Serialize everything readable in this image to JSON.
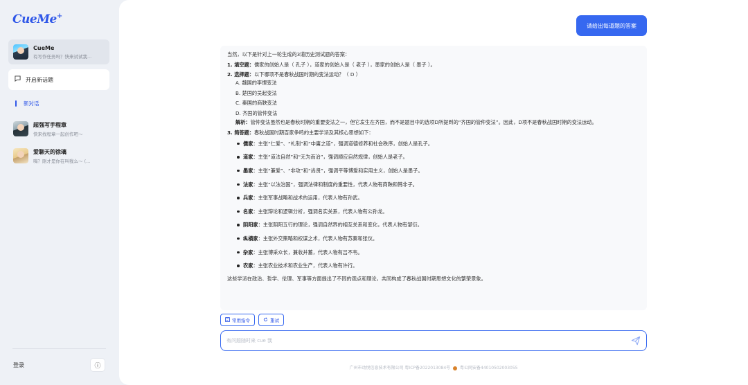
{
  "app": {
    "logo": "CueMe",
    "logo_plus": "+"
  },
  "sidebar": {
    "items": [
      {
        "title": "CueMe",
        "subtitle": "有写作任务吗？快来试试我..."
      },
      {
        "title": "超强写手程章",
        "subtitle": "快来找程章一起创作吧～"
      },
      {
        "title": "爱聊天的徐璃",
        "subtitle": "嗨？刚才是你在叫我么～ (..."
      }
    ],
    "new_topic": "开启新话题",
    "new_chat": "新对话",
    "login": "登录",
    "info_icon": "ⓘ"
  },
  "chat": {
    "user_message": "请给出每道题的答案",
    "answer": {
      "intro": "当然，以下是针对上一轮生成的3道历史测试题的答案：",
      "q1_head": "1. 填空题：",
      "q1_text": "儒家的创始人是（ 孔子 ），道家的创始人是（ 老子 ），墨家的创始人是（ 墨子 ）。",
      "q2_head": "2. 选择题：",
      "q2_text": "以下哪项不是春秋战国时期的变法运动？（ D ）",
      "q2_options": [
        "A. 魏国的李悝变法",
        "B. 楚国的吴起变法",
        "C. 秦国的商鞅变法",
        "D. 齐国的管仲变法"
      ],
      "q2_analysis_head": "解析：",
      "q2_analysis": "管仲变法虽然也是春秋时期的重要变法之一，但它发生在齐国，而不是题目中的选项D所提到的“齐国的管仲变法”。因此，D项不是春秋战国时期的变法运动。",
      "q3_head": "3. 简答题：",
      "q3_text": "春秋战国时期百家争鸣的主要学派及其核心思想如下：",
      "schools": [
        {
          "name": "儒家",
          "text": "：主张“仁爱”、“礼制”和“中庸之道”，强调道德修养和社会秩序，创始人是孔子。"
        },
        {
          "name": "道家",
          "text": "：主张“道法自然”和“无为而治”，强调顺应自然规律，创始人是老子。"
        },
        {
          "name": "墨家",
          "text": "：主张“兼爱”、“非攻”和“尚贤”，强调平等博爱和实用主义，创始人是墨子。"
        },
        {
          "name": "法家",
          "text": "：主张“以法治国”，强调法律和制度的重要性，代表人物有商鞅和韩非子。"
        },
        {
          "name": "兵家",
          "text": "：主张军事战略和战术的运用，代表人物有孙武。"
        },
        {
          "name": "名家",
          "text": "：主张辩论和逻辑分析，强调名实关系，代表人物有公孙龙。"
        },
        {
          "name": "阴阳家",
          "text": "：主张阴阳五行的理论，强调自然界的相互关系和变化，代表人物有邹衍。"
        },
        {
          "name": "纵横家",
          "text": "：主张外交策略和权谋之术，代表人物有苏秦和张仪。"
        },
        {
          "name": "杂家",
          "text": "：主张博采众长，兼收并蓄，代表人物有吕不韦。"
        },
        {
          "name": "农家",
          "text": "：主张农业技术和农业生产，代表人物有许行。"
        }
      ],
      "conclusion": "这些学派在政治、哲学、伦理、军事等方面提出了不同的观点和理论，共同构成了春秋战国时期思想文化的繁荣景象。"
    },
    "actions": {
      "common_commands": "常用指令",
      "retry": "重试"
    },
    "input": {
      "placeholder": "有问题随时来 cue 我",
      "value": ""
    },
    "footer": {
      "company": "广州市动悦信息技术有限公司 粤ICP备2022013084号",
      "police": "粤公网安备44010502003055"
    }
  },
  "colors": {
    "accent": "#3668f0",
    "sidebar_bg": "#eef1f6",
    "main_bg": "#ffffff"
  }
}
